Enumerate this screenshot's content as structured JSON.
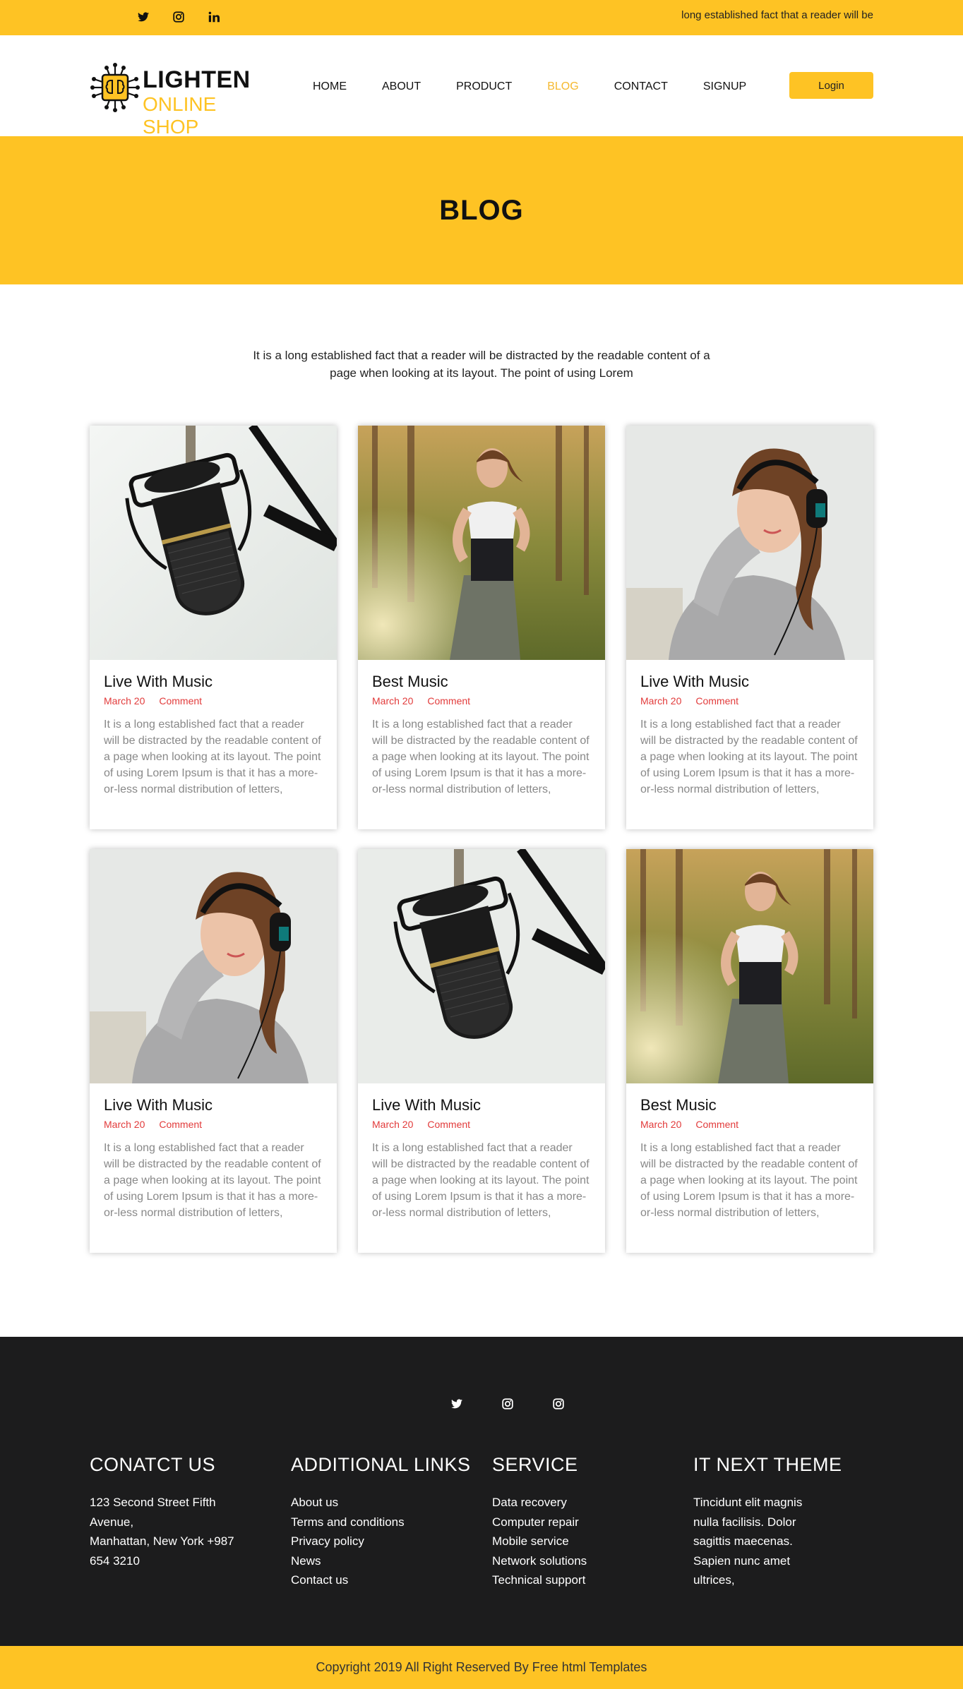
{
  "topbar": {
    "socials": [
      "twitter-icon",
      "instagram-icon",
      "linkedin-icon"
    ],
    "tagline": "long established fact that a reader will be"
  },
  "logo": {
    "line1": "LIGHTEN",
    "line2": "ONLINE SHOP"
  },
  "nav": {
    "items": [
      "HOME",
      "ABOUT",
      "PRODUCT",
      "BLOG",
      "CONTACT",
      "SIGNUP"
    ],
    "active": "BLOG"
  },
  "login": "Login",
  "hero": {
    "title": "BLOG"
  },
  "intro": "It is a long established fact that a reader will be distracted by the readable content of a page when looking at its layout. The point of using Lorem",
  "cards": [
    {
      "title": "Live With Music",
      "date": "March 20",
      "comment": "Comment",
      "image": "microphone",
      "text": "It is a long established fact that a reader will be distracted by the readable content of a page when looking at its layout. The point of using Lorem Ipsum is that it has a more-or-less normal distribution of letters,"
    },
    {
      "title": "Best Music",
      "date": "March 20",
      "comment": "Comment",
      "image": "runner",
      "text": "It is a long established fact that a reader will be distracted by the readable content of a page when looking at its layout. The point of using Lorem Ipsum is that it has a more-or-less normal distribution of letters,"
    },
    {
      "title": "Live With Music",
      "date": "March 20",
      "comment": "Comment",
      "image": "headphones-woman",
      "text": "It is a long established fact that a reader will be distracted by the readable content of a page when looking at its layout. The point of using Lorem Ipsum is that it has a more-or-less normal distribution of letters,"
    },
    {
      "title": "Live With Music",
      "date": "March 20",
      "comment": "Comment",
      "image": "headphones-woman",
      "text": "It is a long established fact that a reader will be distracted by the readable content of a page when looking at its layout. The point of using Lorem Ipsum is that it has a more-or-less normal distribution of letters,"
    },
    {
      "title": "Live With Music",
      "date": "March 20",
      "comment": "Comment",
      "image": "microphone",
      "text": "It is a long established fact that a reader will be distracted by the readable content of a page when looking at its layout. The point of using Lorem Ipsum is that it has a more-or-less normal distribution of letters,"
    },
    {
      "title": "Best Music",
      "date": "March 20",
      "comment": "Comment",
      "image": "runner",
      "text": "It is a long established fact that a reader will be distracted by the readable content of a page when looking at its layout. The point of using Lorem Ipsum is that it has a more-or-less normal distribution of letters,"
    }
  ],
  "footer": {
    "socials": [
      "twitter-icon",
      "instagram-icon",
      "instagram-icon"
    ],
    "columns": [
      {
        "title": "CONATCT US",
        "items": [
          "123 Second Street Fifth",
          "Avenue,",
          "Manhattan, New York +987",
          "654 3210"
        ]
      },
      {
        "title": "ADDITIONAL LINKS",
        "items": [
          "About us",
          "Terms and conditions",
          "Privacy policy",
          "News",
          "Contact us"
        ]
      },
      {
        "title": "SERVICE",
        "items": [
          "Data recovery",
          "Computer repair",
          "Mobile service",
          "Network solutions",
          "Technical support"
        ]
      },
      {
        "title": "IT NEXT THEME",
        "items": [
          "Tincidunt elit magnis",
          "nulla facilisis. Dolor",
          "sagittis maecenas.",
          "Sapien nunc amet",
          "ultrices,"
        ]
      }
    ]
  },
  "copyright": "Copyright 2019 All Right Reserved By Free html Templates",
  "colors": {
    "accent": "#fec324",
    "footer": "#1c1c1d",
    "date": "#e23b3b",
    "active_nav": "#f5b82e"
  }
}
